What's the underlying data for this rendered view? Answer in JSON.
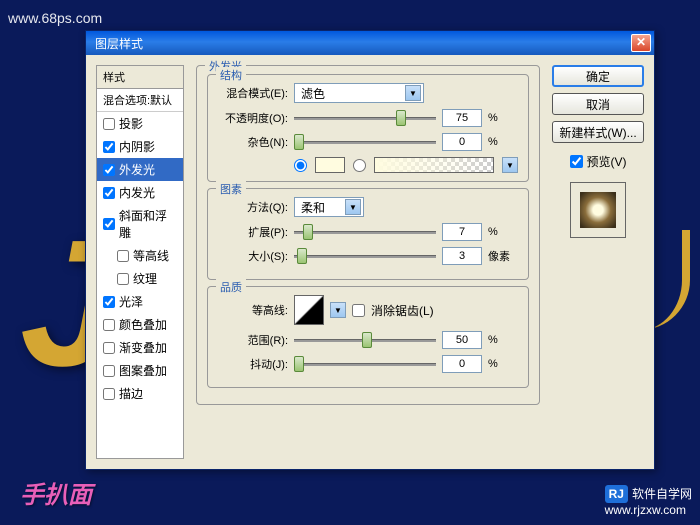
{
  "watermarks": {
    "top_left": "www.68ps.com",
    "bottom_left": "手扒面",
    "bottom_right_text": "软件自学网",
    "bottom_right_url": "www.rjzxw.com",
    "logo": "RJ"
  },
  "dialog": {
    "title": "图层样式"
  },
  "styles": {
    "header": "样式",
    "sub": "混合选项:默认",
    "items": [
      {
        "label": "投影",
        "checked": false,
        "selected": false,
        "indent": false
      },
      {
        "label": "内阴影",
        "checked": true,
        "selected": false,
        "indent": false
      },
      {
        "label": "外发光",
        "checked": true,
        "selected": true,
        "indent": false
      },
      {
        "label": "内发光",
        "checked": true,
        "selected": false,
        "indent": false
      },
      {
        "label": "斜面和浮雕",
        "checked": true,
        "selected": false,
        "indent": false
      },
      {
        "label": "等高线",
        "checked": false,
        "selected": false,
        "indent": true
      },
      {
        "label": "纹理",
        "checked": false,
        "selected": false,
        "indent": true
      },
      {
        "label": "光泽",
        "checked": true,
        "selected": false,
        "indent": false
      },
      {
        "label": "颜色叠加",
        "checked": false,
        "selected": false,
        "indent": false
      },
      {
        "label": "渐变叠加",
        "checked": false,
        "selected": false,
        "indent": false
      },
      {
        "label": "图案叠加",
        "checked": false,
        "selected": false,
        "indent": false
      },
      {
        "label": "描边",
        "checked": false,
        "selected": false,
        "indent": false
      }
    ]
  },
  "outer_glow": {
    "title": "外发光",
    "structure": {
      "title": "结构",
      "blend_label": "混合模式(E):",
      "blend_value": "滤色",
      "opacity_label": "不透明度(O):",
      "opacity_value": "75",
      "opacity_unit": "%",
      "noise_label": "杂色(N):",
      "noise_value": "0",
      "noise_unit": "%"
    },
    "elements": {
      "title": "图素",
      "technique_label": "方法(Q):",
      "technique_value": "柔和",
      "spread_label": "扩展(P):",
      "spread_value": "7",
      "spread_unit": "%",
      "size_label": "大小(S):",
      "size_value": "3",
      "size_unit": "像素"
    },
    "quality": {
      "title": "品质",
      "contour_label": "等高线:",
      "antialias_label": "消除锯齿(L)",
      "range_label": "范围(R):",
      "range_value": "50",
      "range_unit": "%",
      "jitter_label": "抖动(J):",
      "jitter_value": "0",
      "jitter_unit": "%"
    }
  },
  "buttons": {
    "ok": "确定",
    "cancel": "取消",
    "new_style": "新建样式(W)...",
    "preview": "预览(V)"
  }
}
